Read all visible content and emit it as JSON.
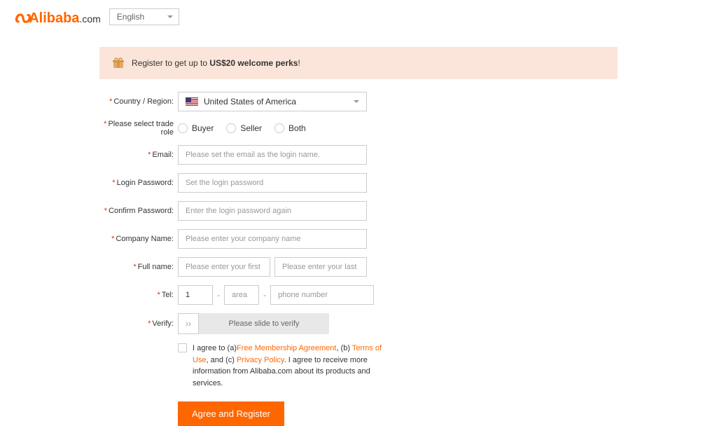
{
  "header": {
    "logo_text": "Alibaba",
    "logo_suffix": ".com",
    "language": "English"
  },
  "promo": {
    "text_prefix": "Register to get up to ",
    "text_bold": "US$20 welcome perks",
    "text_suffix": "!"
  },
  "form": {
    "country": {
      "label": "Country / Region:",
      "value": "United States of America"
    },
    "trade_role": {
      "label": "Please select trade role",
      "options": [
        "Buyer",
        "Seller",
        "Both"
      ]
    },
    "email": {
      "label": "Email:",
      "placeholder": "Please set the email as the login name."
    },
    "password": {
      "label": "Login Password:",
      "placeholder": "Set the login password"
    },
    "confirm_password": {
      "label": "Confirm Password:",
      "placeholder": "Enter the login password again"
    },
    "company": {
      "label": "Company Name:",
      "placeholder": "Please enter your company name"
    },
    "full_name": {
      "label": "Full name:",
      "first_placeholder": "Please enter your first name",
      "last_placeholder": "Please enter your last name"
    },
    "tel": {
      "label": "Tel:",
      "code_value": "1",
      "area_placeholder": "area",
      "phone_placeholder": "phone number"
    },
    "verify": {
      "label": "Verify:",
      "slider_text": "Please slide to verify"
    },
    "agreement": {
      "prefix1": "I agree to (a)",
      "link1": "Free Membership Agreement",
      "mid1": ", (b) ",
      "link2": "Terms of Use",
      "mid2": ", and (c) ",
      "link3": "Privacy Policy",
      "suffix": ". I agree to receive more information from Alibaba.com about its products and services."
    },
    "submit": "Agree and Register"
  }
}
